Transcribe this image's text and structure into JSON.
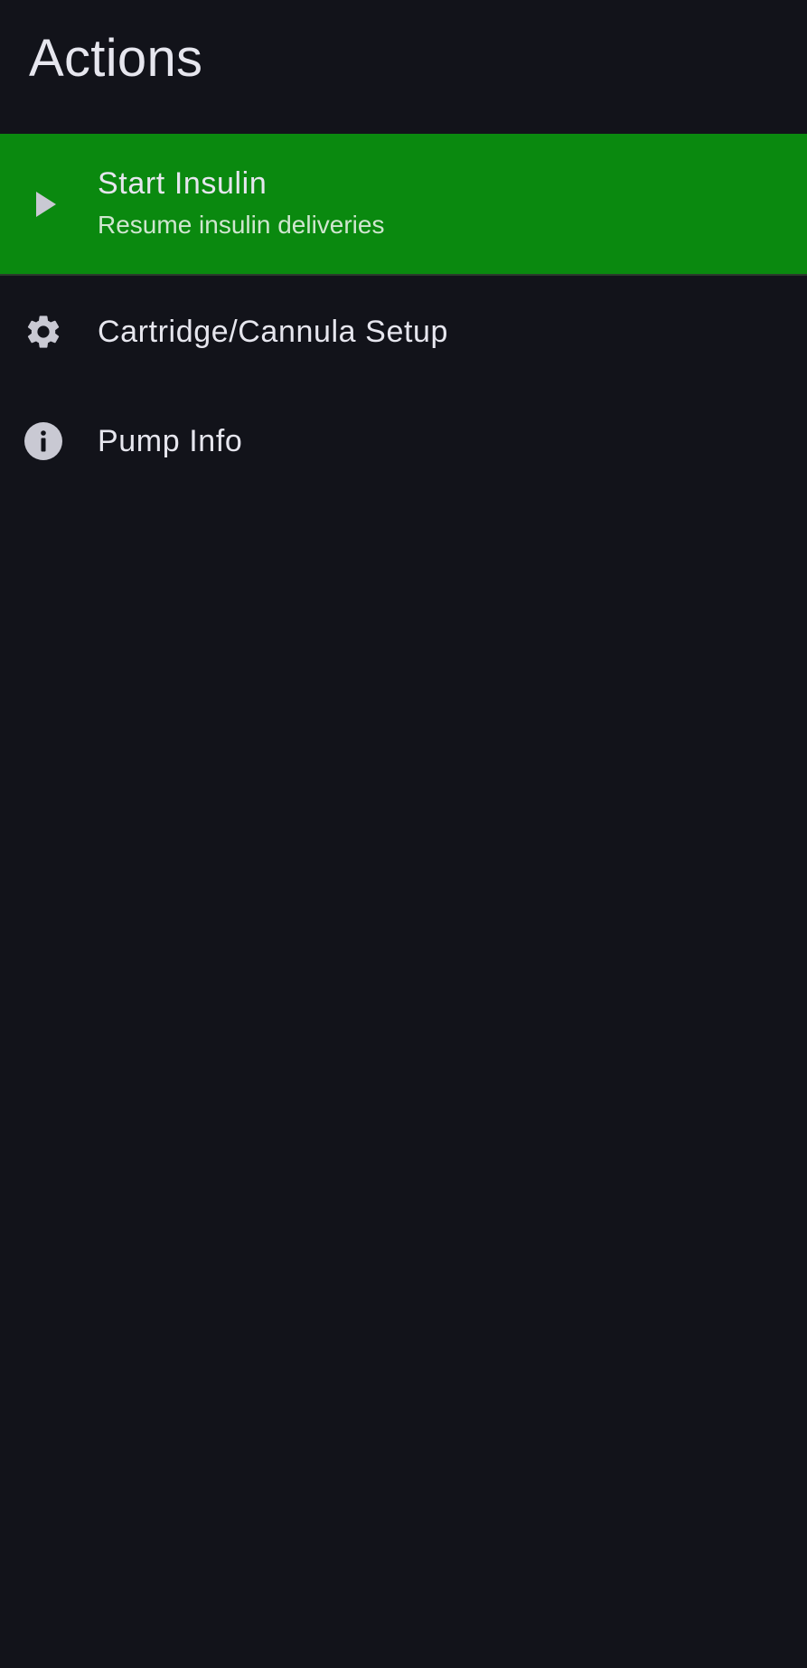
{
  "header": {
    "title": "Actions"
  },
  "menu": {
    "items": [
      {
        "icon": "play-icon",
        "label": "Start Insulin",
        "sublabel": "Resume insulin deliveries",
        "highlight_color": "#0a890f"
      },
      {
        "icon": "gear-icon",
        "label": "Cartridge/Cannula Setup"
      },
      {
        "icon": "info-icon",
        "label": "Pump Info"
      }
    ]
  },
  "colors": {
    "background": "#12131a",
    "accent_green": "#0a890f",
    "icon": "#c9c9d3",
    "text": "#e6e6ee"
  }
}
